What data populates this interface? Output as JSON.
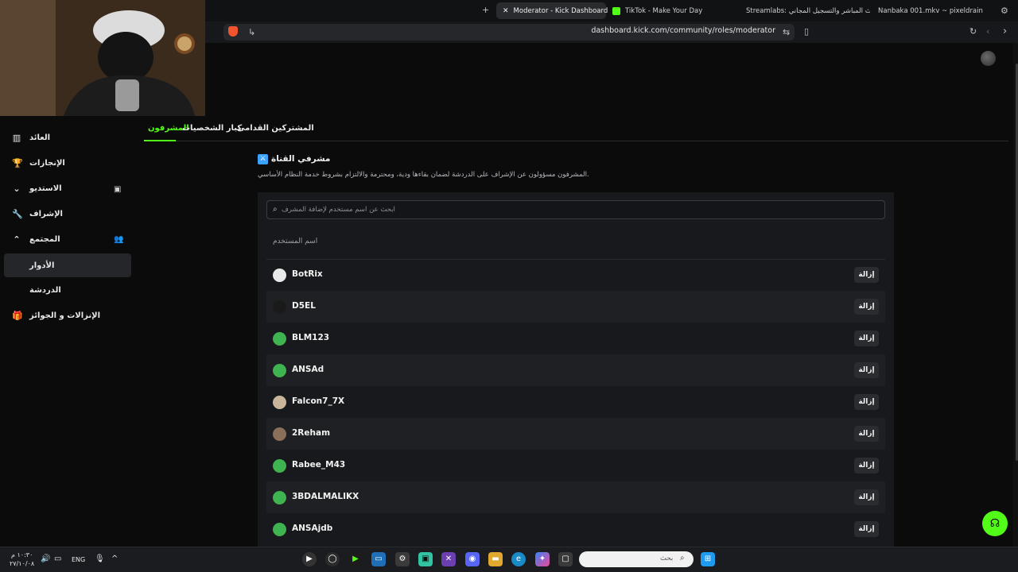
{
  "browser": {
    "tabs": [
      {
        "label": "Moderator - Kick Dashboard",
        "active": true
      },
      {
        "label": "TikTok - Make Your Day",
        "active": false
      },
      {
        "label": "Streamlabs: البث المباشر والتسجيل المجاني",
        "active": false
      },
      {
        "label": "Nanbaka 001.mkv ~ pixeldrain",
        "active": false
      }
    ],
    "new_tab": "+",
    "url": "dashboard.kick.com/community/roles/moderator"
  },
  "sidebar": {
    "items": [
      {
        "label": "العائد"
      },
      {
        "label": "الإنجازات"
      },
      {
        "label": "الاستديو"
      },
      {
        "label": "الإشراف"
      },
      {
        "label": "المجتمع"
      },
      {
        "label": "الأدوار"
      },
      {
        "label": "الدردشة"
      },
      {
        "label": "الإنزالات و الجوائز"
      }
    ]
  },
  "main": {
    "tabs": [
      {
        "label": "المشرفون",
        "active": true
      },
      {
        "label": "كبار الشخصيات",
        "active": false
      },
      {
        "label": "المشتركين القدامى",
        "active": false
      }
    ],
    "section_title": "مشرفي القناة",
    "section_desc": "المشرفون مسؤولون عن الإشراف على الدردشة لضمان بقاءها ودية، ومحترمة والالتزام بشروط خدمة النظام الأساسي.",
    "search_placeholder": "ابحث عن اسم مستخدم لإضافة المشرف",
    "column_username": "اسم المستخدم",
    "remove_label": "إزالة",
    "moderators": [
      {
        "name": "BotRix"
      },
      {
        "name": "D5EL"
      },
      {
        "name": "BLM123"
      },
      {
        "name": "ANSAd"
      },
      {
        "name": "Falcon7_7X"
      },
      {
        "name": "2Reham"
      },
      {
        "name": "Rabee_M43"
      },
      {
        "name": "3BDALMALIKX"
      },
      {
        "name": "ANSAjdb"
      }
    ]
  },
  "taskbar": {
    "search_placeholder": "بحث",
    "language": "ENG",
    "time": "١٠:٣٠ م",
    "date": "٢٧/١٠/٠٨"
  },
  "colors": {
    "accent": "#53fc18",
    "background": "#0b0b0c",
    "panel": "#18191c"
  }
}
